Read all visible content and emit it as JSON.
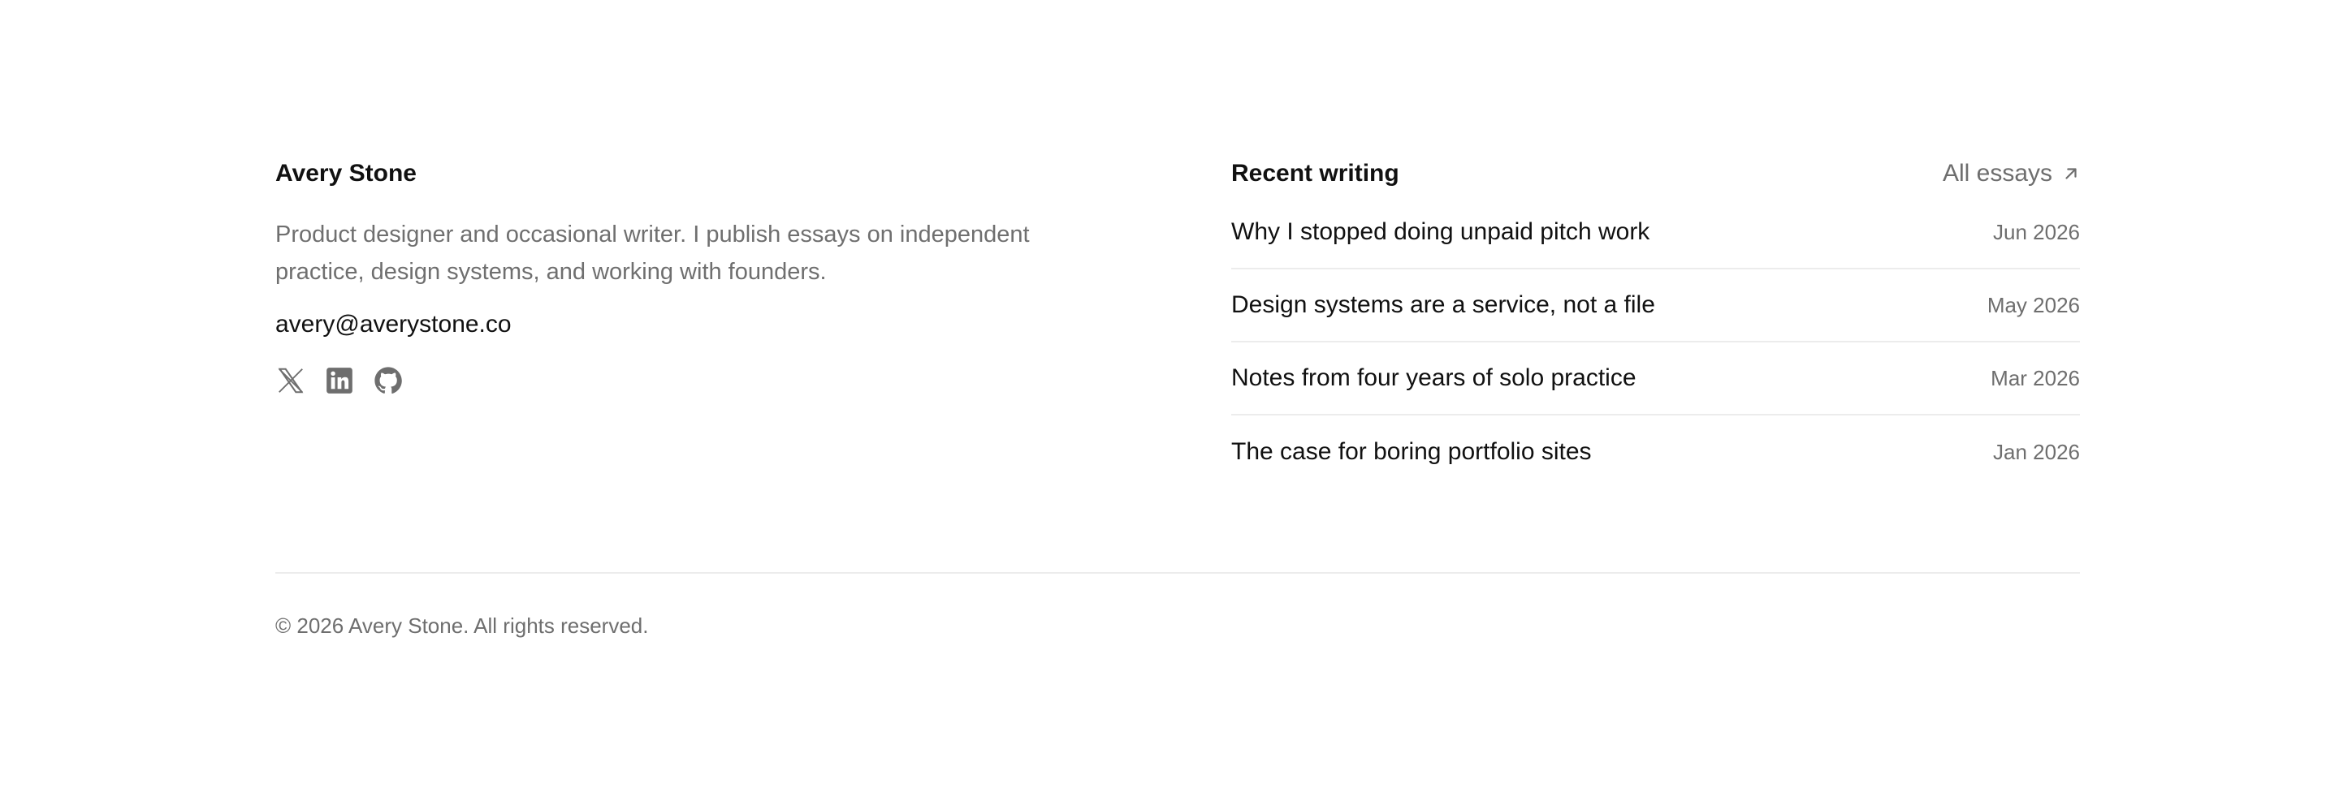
{
  "profile": {
    "name": "Avery Stone",
    "bio": "Product designer and occasional writer. I publish essays on independent practice, design systems, and working with founders.",
    "email": "avery@averystone.co",
    "social": [
      {
        "icon": "x-twitter-icon"
      },
      {
        "icon": "linkedin-icon"
      },
      {
        "icon": "github-icon"
      }
    ]
  },
  "writing": {
    "title": "Recent writing",
    "all_link": "All essays",
    "essays": [
      {
        "title": "Why I stopped doing unpaid pitch work",
        "date": "Jun 2026"
      },
      {
        "title": "Design systems are a service, not a file",
        "date": "May 2026"
      },
      {
        "title": "Notes from four years of solo practice",
        "date": "Mar 2026"
      },
      {
        "title": "The case for boring portfolio sites",
        "date": "Jan 2026"
      }
    ]
  },
  "footer": {
    "copyright": "© 2026 Avery Stone. All rights reserved."
  },
  "colors": {
    "text": "#111111",
    "muted": "#6e6e6e",
    "divider": "#ececec",
    "background": "#ffffff"
  }
}
